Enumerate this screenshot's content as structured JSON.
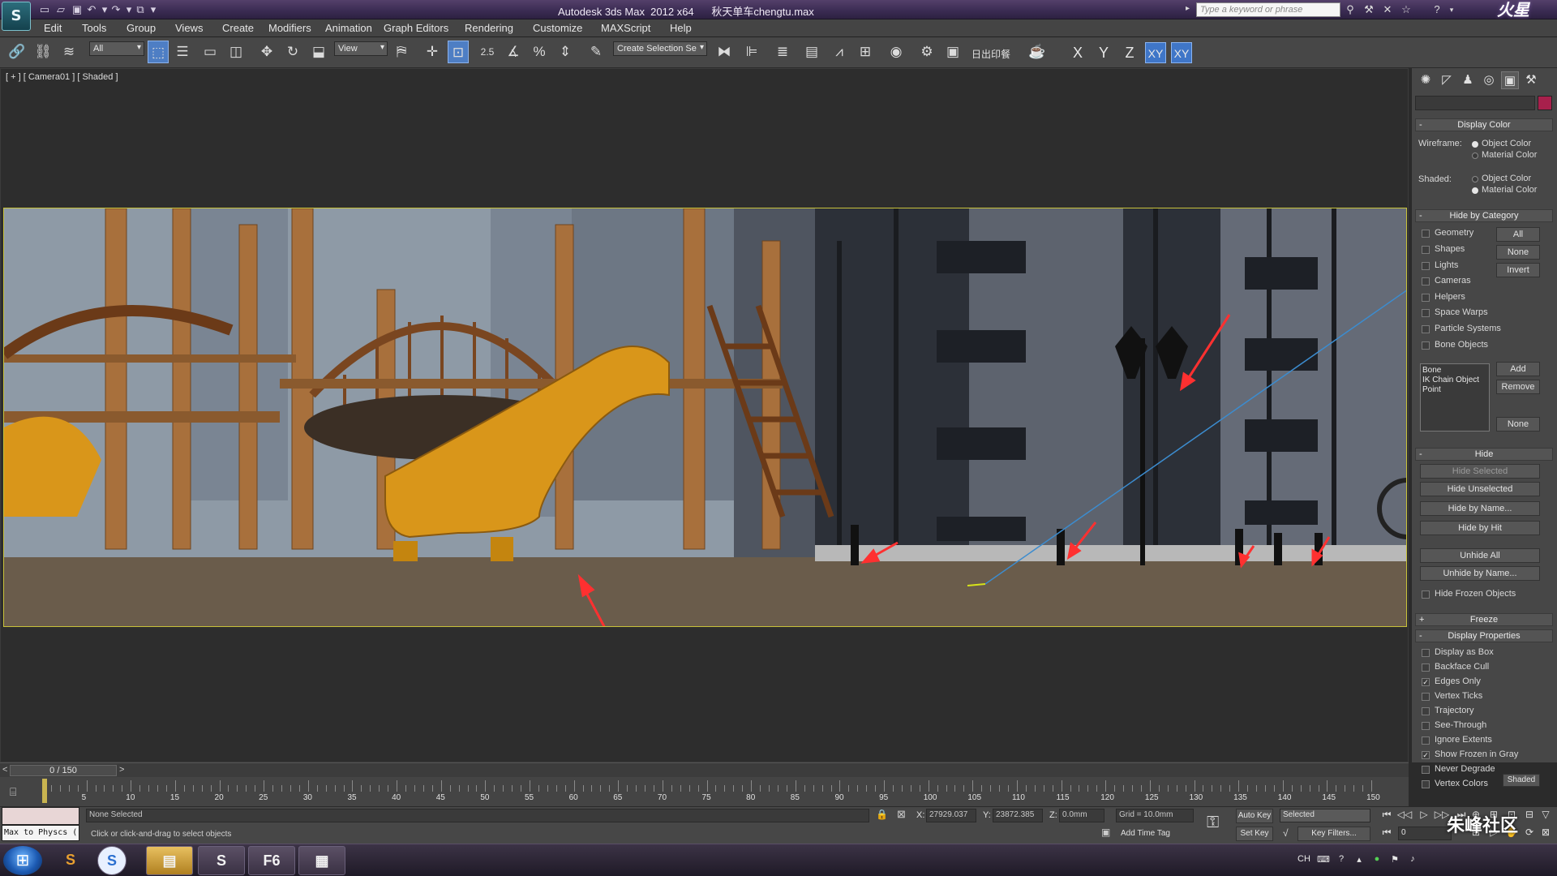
{
  "window": {
    "title": "Autodesk 3ds Max  2012 x64      秋天单车chengtu.max",
    "search_placeholder": "Type a keyword or phrase",
    "logo": "S",
    "brand": "火星"
  },
  "menu": [
    "Edit",
    "Tools",
    "Group",
    "Views",
    "Create",
    "Modifiers",
    "Animation",
    "Graph Editors",
    "Rendering",
    "Customize",
    "MAXScript",
    "Help"
  ],
  "toolbar": {
    "filter_value": "All",
    "ref_coord_value": "View",
    "snap_value": "2.5",
    "selection_set_placeholder": "Create Selection Se",
    "chinese_label": "日出印餐",
    "axes": [
      "X",
      "Y",
      "Z",
      "XY",
      "XY"
    ]
  },
  "viewport": {
    "label": "[ + ] [ Camera01 ] [ Shaded ]"
  },
  "command_panel": {
    "display_color": {
      "title": "Display Color",
      "wireframe_label": "Wireframe:",
      "shaded_label": "Shaded:",
      "object_color": "Object Color",
      "material_color": "Material Color",
      "wireframe_selected": "Object Color",
      "shaded_selected": "Material Color"
    },
    "hide_by_category": {
      "title": "Hide by Category",
      "items": [
        "Geometry",
        "Shapes",
        "Lights",
        "Cameras",
        "Helpers",
        "Space Warps",
        "Particle Systems",
        "Bone Objects"
      ],
      "buttons": [
        "All",
        "None",
        "Invert"
      ],
      "list_items": [
        "Bone",
        "IK Chain Object",
        "Point"
      ],
      "add": "Add",
      "remove": "Remove",
      "none": "None"
    },
    "hide": {
      "title": "Hide",
      "buttons": [
        "Hide Selected",
        "Hide Unselected",
        "Hide by Name...",
        "Hide by Hit"
      ],
      "unhide_buttons": [
        "Unhide All",
        "Unhide by Name..."
      ],
      "hide_frozen": "Hide Frozen Objects"
    },
    "freeze": {
      "title": "Freeze"
    },
    "display_properties": {
      "title": "Display Properties",
      "items": [
        {
          "label": "Display as Box",
          "checked": false
        },
        {
          "label": "Backface Cull",
          "checked": false
        },
        {
          "label": "Edges Only",
          "checked": true
        },
        {
          "label": "Vertex Ticks",
          "checked": false
        },
        {
          "label": "Trajectory",
          "checked": false
        },
        {
          "label": "See-Through",
          "checked": false
        },
        {
          "label": "Ignore Extents",
          "checked": false
        },
        {
          "label": "Show Frozen in Gray",
          "checked": true
        },
        {
          "label": "Never Degrade",
          "checked": false
        },
        {
          "label": "Vertex Colors",
          "checked": false
        }
      ],
      "shaded_button": "Shaded"
    }
  },
  "timeline": {
    "frame_display": "0 / 150",
    "ticks": [
      "5",
      "10",
      "15",
      "20",
      "25",
      "30",
      "35",
      "40",
      "45",
      "50",
      "55",
      "60",
      "65",
      "70",
      "75",
      "80",
      "85",
      "90",
      "95",
      "100",
      "105",
      "110",
      "115",
      "120",
      "125",
      "130",
      "135",
      "140",
      "145",
      "150"
    ]
  },
  "status": {
    "script_listener": "Max to Physcs (",
    "selection": "None Selected",
    "prompt": "Click or click-and-drag to select objects",
    "x_label": "X:",
    "x_value": "27929.037",
    "y_label": "Y:",
    "y_value": "23872.385",
    "z_label": "Z:",
    "z_value": "0.0mm",
    "grid": "Grid = 10.0mm",
    "add_time_tag": "Add Time Tag",
    "auto_key": "Auto Key",
    "set_key": "Set Key",
    "key_mode": "Selected",
    "key_filters": "Key Filters...",
    "current_frame": "0"
  },
  "taskbar": {
    "apps": [
      "S",
      "▤",
      "S",
      "F6",
      "▦"
    ],
    "tray_lang": "CH",
    "watermark": "朱峰社区"
  },
  "colors": {
    "active_button": "#4e7ec4",
    "frame_border": "#c8c23a",
    "slide_orange": "#d9961a",
    "wood": "#a8703c",
    "annotation_red": "#ff3030"
  }
}
